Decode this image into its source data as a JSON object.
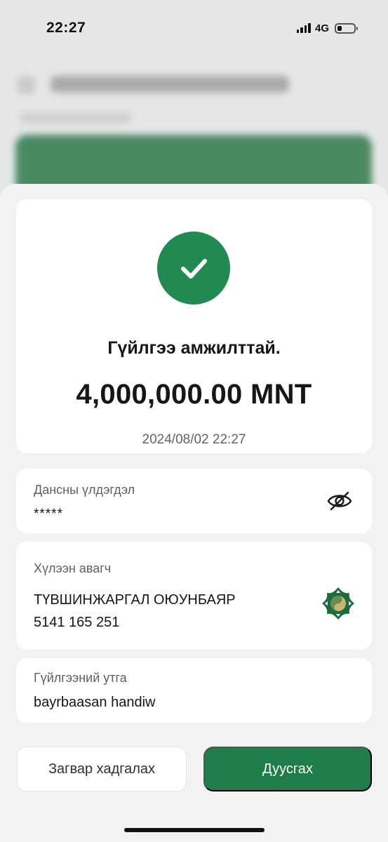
{
  "status_bar": {
    "time": "22:27",
    "network": "4G",
    "battery_level": 0.25
  },
  "success_card": {
    "icon": "check-icon",
    "title": "Гүйлгээ амжилттай.",
    "amount": "4,000,000.00 MNT",
    "datetime": "2024/08/02 22:27"
  },
  "balance_card": {
    "label": "Дансны үлдэгдэл",
    "value": "*****",
    "icon": "eye-off-icon"
  },
  "recipient_card": {
    "label": "Хүлээн авагч",
    "name": "ТҮВШИНЖАРГАЛ ОЮУНБАЯР",
    "account": "5141 165 251",
    "icon": "bank-logo-icon"
  },
  "description_card": {
    "label": "Гүйлгээний утга",
    "value": "bayrbaasan handiw"
  },
  "buttons": {
    "save_template": "Загвар хадгалах",
    "finish": "Дуусгах"
  },
  "colors": {
    "accent": "#218a50",
    "primary_button": "#1f7d49",
    "background": "#f1f3f2"
  }
}
